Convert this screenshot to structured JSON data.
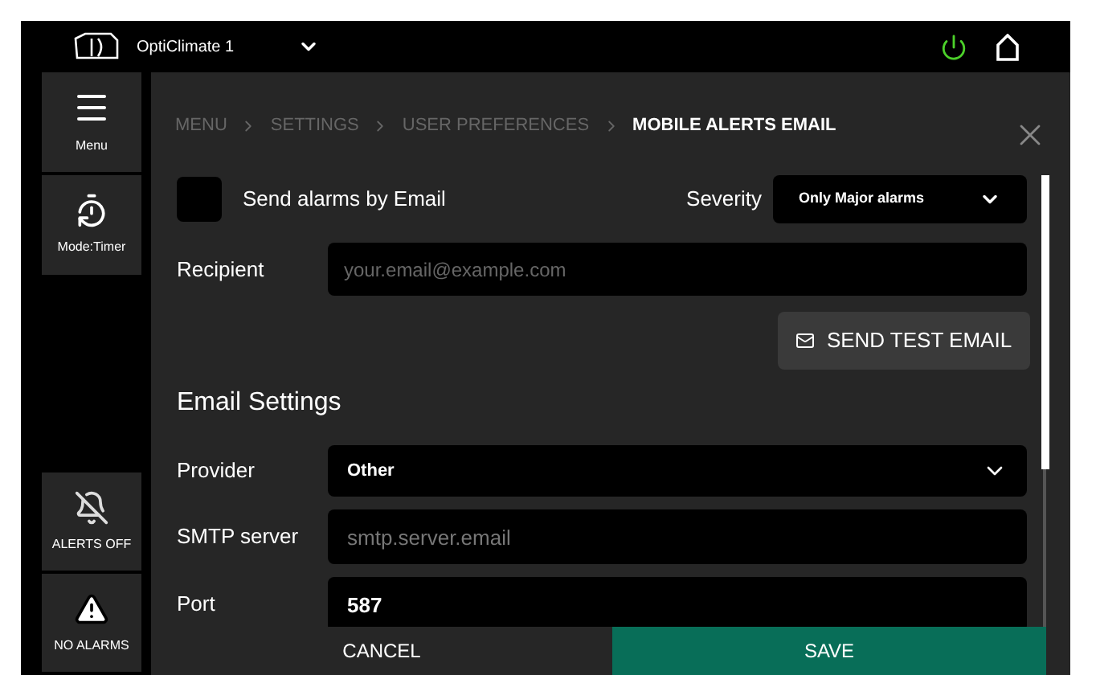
{
  "header": {
    "device_name": "OptiClimate 1"
  },
  "sidebar": {
    "items": [
      {
        "kind": "menu",
        "label": "Menu"
      },
      {
        "kind": "timer",
        "label": "Mode:Timer"
      },
      {
        "kind": "alerts",
        "label": "ALERTS OFF"
      },
      {
        "kind": "alarms",
        "label": "NO ALARMS"
      }
    ]
  },
  "breadcrumb": [
    {
      "label": "MENU",
      "current": false
    },
    {
      "label": "SETTINGS",
      "current": false
    },
    {
      "label": "USER PREFERENCES",
      "current": false
    },
    {
      "label": "MOBILE ALERTS EMAIL",
      "current": true
    }
  ],
  "send_by_email": {
    "label": "Send alarms by Email",
    "checked": false
  },
  "severity": {
    "label": "Severity",
    "value": "Only Major alarms"
  },
  "recipient": {
    "label": "Recipient",
    "placeholder": "your.email@example.com"
  },
  "test_button": "SEND TEST EMAIL",
  "email_settings": {
    "title": "Email Settings",
    "fields": [
      {
        "kind": "select",
        "label": "Provider",
        "value": "Other"
      },
      {
        "kind": "input",
        "label": "SMTP server",
        "placeholder": "smtp.server.email"
      },
      {
        "kind": "input",
        "label": "Port",
        "value": "587"
      }
    ]
  },
  "footer": {
    "cancel": "CANCEL",
    "save": "SAVE"
  }
}
